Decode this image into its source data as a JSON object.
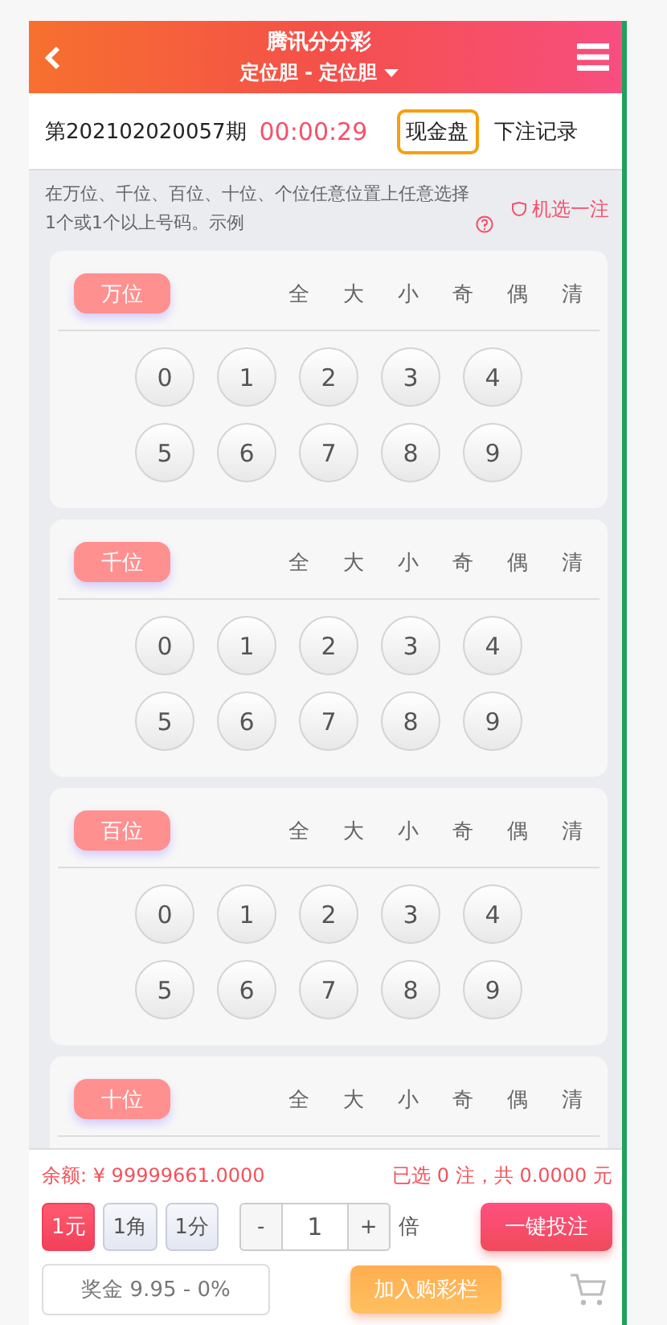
{
  "header": {
    "title": "腾讯分分彩",
    "subtitle": "定位胆 - 定位胆"
  },
  "issue": {
    "number": "第202102020057期",
    "countdown": "00:00:29",
    "mode_button": "现金盘",
    "history_link": "下注记录"
  },
  "hint": {
    "text": "在万位、千位、百位、十位、个位任意位置上任意选择1个或1个以上号码。示例",
    "random_pick": "机选一注"
  },
  "positions": [
    {
      "label": "万位",
      "filters": [
        "全",
        "大",
        "小",
        "奇",
        "偶",
        "清"
      ],
      "numbers": [
        "0",
        "1",
        "2",
        "3",
        "4",
        "5",
        "6",
        "7",
        "8",
        "9"
      ]
    },
    {
      "label": "千位",
      "filters": [
        "全",
        "大",
        "小",
        "奇",
        "偶",
        "清"
      ],
      "numbers": [
        "0",
        "1",
        "2",
        "3",
        "4",
        "5",
        "6",
        "7",
        "8",
        "9"
      ]
    },
    {
      "label": "百位",
      "filters": [
        "全",
        "大",
        "小",
        "奇",
        "偶",
        "清"
      ],
      "numbers": [
        "0",
        "1",
        "2",
        "3",
        "4",
        "5",
        "6",
        "7",
        "8",
        "9"
      ]
    },
    {
      "label": "十位",
      "filters": [
        "全",
        "大",
        "小",
        "奇",
        "偶",
        "清"
      ]
    }
  ],
  "footer": {
    "balance": "余额: ¥ 99999661.0000",
    "summary": "已选 0 注，共 0.0000 元",
    "units": [
      {
        "label": "1元",
        "selected": true
      },
      {
        "label": "1角",
        "selected": false
      },
      {
        "label": "1分",
        "selected": false
      }
    ],
    "multiplier": {
      "minus": "-",
      "value": "1",
      "plus": "+",
      "unit": "倍"
    },
    "submit": "一键投注",
    "prize": "奖金 9.95 - 0%",
    "add_to_cart": "加入购彩栏"
  }
}
